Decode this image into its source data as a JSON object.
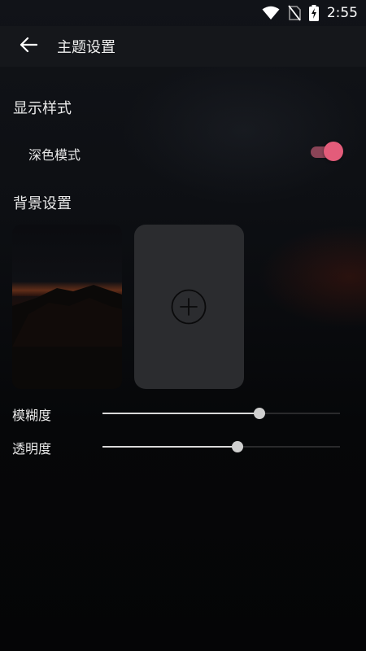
{
  "status_bar": {
    "time": "2:55",
    "icons": [
      "wifi-icon",
      "no-sim-icon",
      "battery-charging-icon"
    ]
  },
  "app_bar": {
    "back_icon": "arrow-left-icon",
    "title": "主题设置"
  },
  "display_style": {
    "title": "显示样式",
    "dark_mode": {
      "label": "深色模式",
      "enabled": true,
      "accent_color": "#e35c7a"
    }
  },
  "background": {
    "title": "背景设置",
    "add_icon": "plus-circle-icon"
  },
  "sliders": [
    {
      "label": "模糊度",
      "value": 0.66
    },
    {
      "label": "透明度",
      "value": 0.57
    }
  ]
}
